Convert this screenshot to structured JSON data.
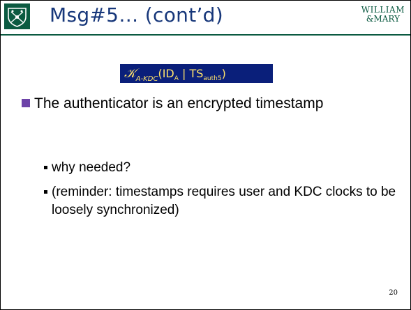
{
  "slide": {
    "title": "Msg#5… (cont’d)",
    "logo_lines": [
      "WILLIAM",
      "&MARY"
    ],
    "formula": {
      "k_symbol": "𝒦",
      "k_subscript": "A-KDC",
      "paren_open": "(",
      "id": "ID",
      "id_sub": "A",
      "sep": " | ",
      "ts": "TS",
      "ts_sub": "auth5",
      "paren_close": ")"
    },
    "bullet": {
      "text": "The authenticator is an encrypted timestamp"
    },
    "sub_items": [
      "why needed?",
      "(reminder: timestamps requires user and KDC clocks to be loosely synchronized)"
    ],
    "page_number": "20"
  },
  "colors": {
    "title_color": "#17377a",
    "logo_green": "#0b5a41",
    "formula_bg": "#0a1f7a",
    "formula_text": "#ffe36b",
    "bullet_purple": "#6d43a8"
  }
}
